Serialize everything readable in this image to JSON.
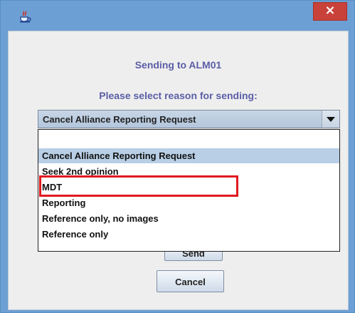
{
  "window": {
    "close_glyph": "×",
    "app_icon": "java-coffee-cup-icon"
  },
  "dialog": {
    "title_line": "Sending to ALM01",
    "prompt_line": "Please select reason for sending:"
  },
  "combo": {
    "selected_value": "Cancel Alliance Reporting Request",
    "arrow_icon": "chevron-down-icon"
  },
  "dropdown": {
    "options": [
      "",
      "Cancel Alliance Reporting Request",
      "Seek 2nd opinion",
      "MDT",
      "Reporting",
      "Reference only, no images",
      "Reference only"
    ],
    "highlighted_index": 1
  },
  "buttons": {
    "send_label": "Send",
    "cancel_label": "Cancel"
  },
  "colors": {
    "accent_blue": "#6c9fd3",
    "heading": "#5b5ea6",
    "highlight_red": "#e0191f",
    "selected_row": "#b8cfe5"
  }
}
